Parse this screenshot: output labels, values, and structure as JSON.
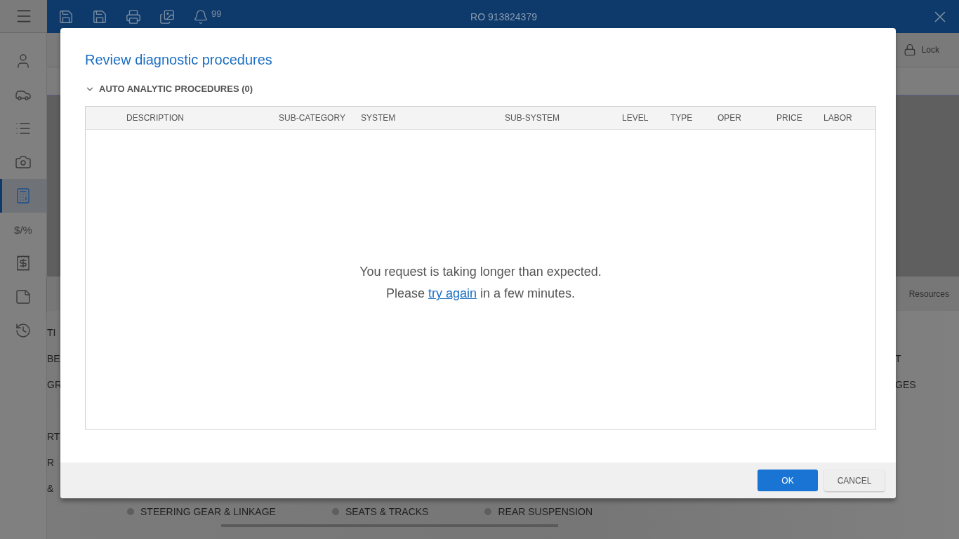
{
  "header": {
    "title": "RO 913824379",
    "notification_count": "99"
  },
  "sidebar": {
    "items": [
      {
        "kind": "icon",
        "selected": false
      },
      {
        "kind": "icon",
        "selected": false
      },
      {
        "kind": "icon",
        "selected": false
      },
      {
        "kind": "icon",
        "selected": false
      },
      {
        "kind": "icon",
        "selected": true
      },
      {
        "kind": "glyph",
        "glyph": "$/%",
        "selected": false
      },
      {
        "kind": "icon",
        "selected": false
      },
      {
        "kind": "icon",
        "selected": false
      },
      {
        "kind": "icon",
        "selected": false
      }
    ]
  },
  "toolbar": {
    "lock_label": "Lock"
  },
  "panel": {
    "tab": "Resources",
    "left_groups": [
      [
        "TI",
        "BE",
        "GR"
      ],
      [
        "RT",
        "R",
        "&"
      ]
    ],
    "right_items": [
      "T",
      "GES"
    ],
    "bottom_items": [
      "STEERING GEAR & LINKAGE",
      "SEATS & TRACKS",
      "REAR SUSPENSION"
    ]
  },
  "dialog": {
    "title": "Review diagnostic procedures",
    "section": {
      "label": "AUTO ANALYTIC PROCEDURES (0)",
      "expanded": true
    },
    "columns": [
      "DESCRIPTION",
      "SUB-CATEGORY",
      "SYSTEM",
      "SUB-SYSTEM",
      "LEVEL",
      "TYPE",
      "OPER",
      "PRICE",
      "LABOR"
    ],
    "message_line_1": "You request is taking longer than expected.",
    "message_line_2": {
      "before": "Please ",
      "link": "try again",
      "after": " in a few minutes."
    },
    "buttons": [
      {
        "kind": "primary",
        "label": "OK"
      },
      {
        "kind": "secondary",
        "label": "CANCEL"
      }
    ]
  }
}
